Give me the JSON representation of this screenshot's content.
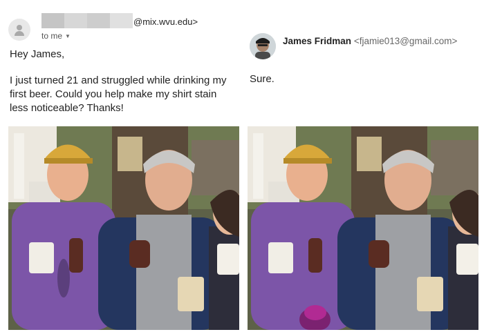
{
  "original_email": {
    "sender_domain": "@mix.wvu.edu>",
    "recipient": "to me",
    "greeting": "Hey James,",
    "body": "I just turned 21 and struggled while drinking my first beer. Could you help make my shirt stain less noticeable? Thanks!",
    "avatar_icon": "person-icon",
    "photo_caption": "Before photo with shirt stain"
  },
  "reply": {
    "sender_name": "James Fridman",
    "sender_address": "<fjamie013@gmail.com>",
    "text": "Sure.",
    "photo_caption": "Edited photo"
  },
  "colors": {
    "shirt_purple": "#7c55a8",
    "cap_yellow": "#d8a83a",
    "text": "#222222",
    "muted": "#666666"
  }
}
